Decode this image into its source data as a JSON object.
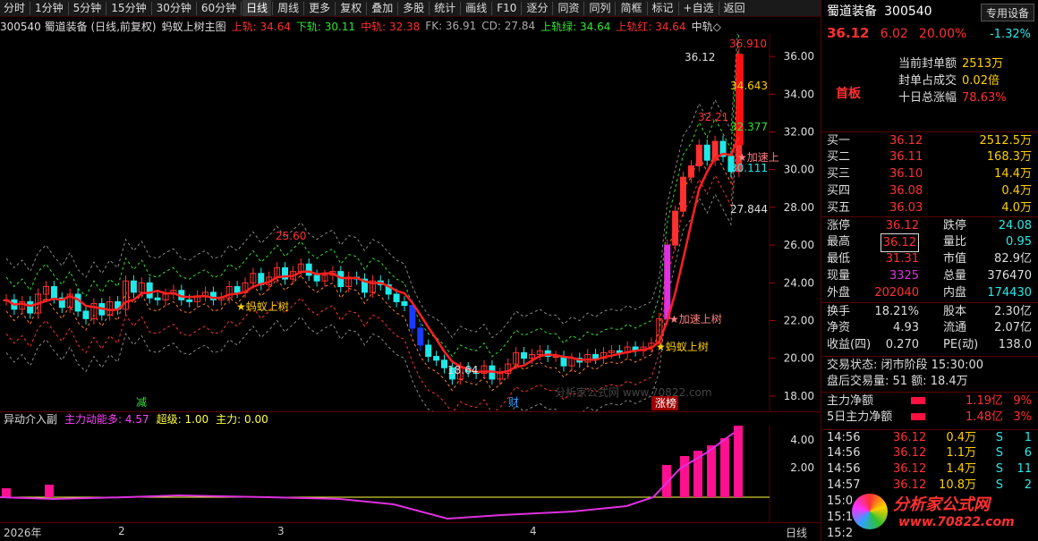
{
  "toolbar": {
    "items": [
      "分时",
      "1分钟",
      "5分钟",
      "15分钟",
      "30分钟",
      "60分钟",
      "日线",
      "周线",
      "更多",
      "复权",
      "叠加",
      "多股",
      "统计",
      "画线",
      "F10",
      "逐分",
      "同资",
      "同列",
      "简框",
      "标记",
      "+自选",
      "返回"
    ],
    "active": "日线"
  },
  "info": {
    "code": "300540 蜀道装备 (日线,前复权)",
    "formula": "蚂蚁上树主图",
    "upper": "上轨: 34.64",
    "lower": "下轨: 30.11",
    "mid": "中轨: 32.38",
    "fk": "FK: 36.91",
    "cd": "CD: 27.84",
    "upper_green": "上轨绿: 34.64",
    "upper_red": "上轨红: 34.64",
    "mid2": "中轨◇"
  },
  "annotations": {
    "high": "36.910",
    "p1": "36.12",
    "p2": "34.643",
    "p3": "32.21",
    "p4": "32.377",
    "p5": "30.111",
    "p6": "27.844",
    "p7": "25.60",
    "p8": "18.64",
    "accel1": "★加速上",
    "accel2": "★加速上树",
    "ant1": "★蚂蚁上树",
    "ant2": "★蚂蚁上树",
    "jian": "减",
    "cai": "财",
    "zhangbang": "涨榜",
    "watermark": "分析家公式网 www.70822.com"
  },
  "sub": {
    "name": "异动介入副",
    "zhuli_energy": "主力动能多: 4.57",
    "chaoji": "超级: 1.00",
    "zhuli": "主力: 0.00"
  },
  "chart_data": {
    "type": "candlestick",
    "ylim": [
      17,
      37
    ],
    "yticks": [
      "36.00",
      "34.00",
      "32.00",
      "30.00",
      "28.00",
      "26.00",
      "24.00",
      "22.00",
      "20.00",
      "18.00"
    ],
    "sub_yticks": [
      "4.00",
      "2.00"
    ],
    "xlabels": [
      "2026年",
      "2",
      "3",
      "4",
      "日线"
    ]
  },
  "quote": {
    "name": "蜀道装备",
    "code": "300540",
    "tag": "专用设备",
    "price": "36.12",
    "change": "6.02",
    "pct": "20.00%",
    "tag_pct": "-1.32%",
    "board": "首板",
    "seal": [
      {
        "k": "当前封单额",
        "v": "2513万"
      },
      {
        "k": "封单占成交",
        "v": "0.02倍"
      },
      {
        "k": "十日总涨幅",
        "v": "78.63%"
      }
    ],
    "bids": [
      {
        "k": "买一",
        "p": "36.12",
        "v": "2512.5万"
      },
      {
        "k": "买二",
        "p": "36.11",
        "v": "168.3万"
      },
      {
        "k": "买三",
        "p": "36.10",
        "v": "14.4万"
      },
      {
        "k": "买四",
        "p": "36.08",
        "v": "0.4万"
      },
      {
        "k": "买五",
        "p": "36.03",
        "v": "4.0万"
      }
    ],
    "stats": [
      {
        "k1": "涨停",
        "v1": "36.12",
        "k2": "跌停",
        "v2": "24.08"
      },
      {
        "k1": "最高",
        "v1": "36.12",
        "k2": "量比",
        "v2": "0.95"
      },
      {
        "k1": "最低",
        "v1": "31.31",
        "k2": "市值",
        "v2": "82.9亿"
      },
      {
        "k1": "现量",
        "v1": "3325",
        "k2": "总量",
        "v2": "376470"
      },
      {
        "k1": "外盘",
        "v1": "202040",
        "k2": "内盘",
        "v2": "174430"
      }
    ],
    "stats2": [
      {
        "k1": "换手",
        "v1": "18.21%",
        "k2": "股本",
        "v2": "2.30亿"
      },
      {
        "k1": "净资",
        "v1": "4.93",
        "k2": "流通",
        "v2": "2.07亿"
      },
      {
        "k1": "收益(四)",
        "v1": "0.270",
        "k2": "PE(动)",
        "v2": "138.0"
      }
    ],
    "trade_status": "交易状态: 闭市阶段 15:30:00",
    "after": "盘后交易量: 51  额: 18.4万",
    "flows": [
      {
        "k": "主力净额",
        "v": "1.19亿",
        "p": "9%"
      },
      {
        "k": "5日主力净额",
        "v": "1.48亿",
        "p": "3%"
      }
    ],
    "ticks": [
      {
        "t": "14:56",
        "p": "36.12",
        "v": "0.4万",
        "s": "S",
        "n": "1"
      },
      {
        "t": "14:56",
        "p": "36.12",
        "v": "1.1万",
        "s": "S",
        "n": "6"
      },
      {
        "t": "14:56",
        "p": "36.12",
        "v": "1.4万",
        "s": "S",
        "n": "11"
      },
      {
        "t": "14:57",
        "p": "36.12",
        "v": "10.8万",
        "s": "S",
        "n": "2"
      },
      {
        "t": "15:0",
        "p": "",
        "v": "",
        "s": "",
        "n": ""
      },
      {
        "t": "15:1",
        "p": "",
        "v": "",
        "s": "",
        "n": ""
      },
      {
        "t": "15:2",
        "p": "",
        "v": "",
        "s": "",
        "n": ""
      }
    ],
    "brand": "分析家公式网",
    "brand_url": "www.70822.com"
  }
}
